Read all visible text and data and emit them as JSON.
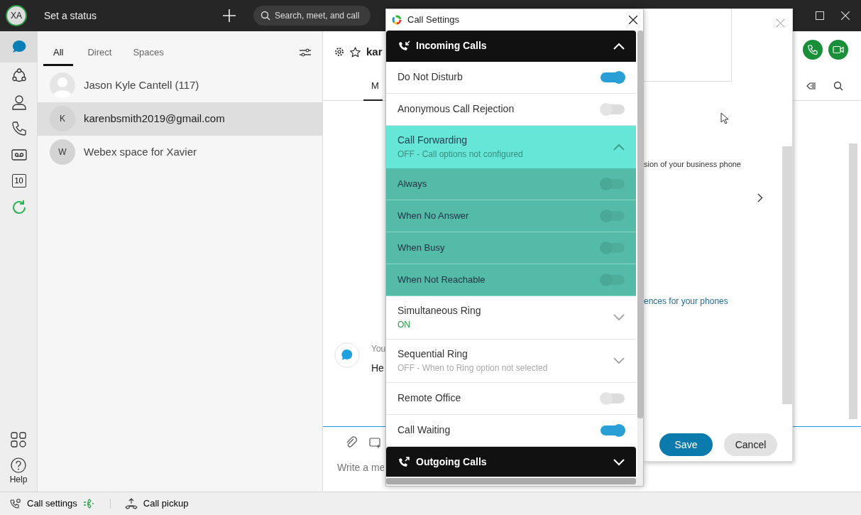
{
  "top_bar": {
    "avatar": "XA",
    "status": "Set a status",
    "search": {
      "placeholder": "Search, meet, and call"
    }
  },
  "rail": {
    "items": [
      {
        "kind": "messaging",
        "selected": true
      },
      {
        "kind": "teams",
        "selected": false
      },
      {
        "kind": "contacts",
        "selected": false
      },
      {
        "kind": "calls",
        "selected": false
      },
      {
        "kind": "voicemail",
        "selected": false
      },
      {
        "kind": "calendar",
        "label": "10",
        "selected": false
      },
      {
        "kind": "refresh",
        "selected": false
      }
    ],
    "help": "Help"
  },
  "list_tabs": [
    {
      "label": "All",
      "selected": true
    },
    {
      "label": "Direct",
      "selected": false
    },
    {
      "label": "Spaces",
      "selected": false
    }
  ],
  "conversations": [
    {
      "kind": "photo",
      "name": "Jason Kyle Cantell (117)",
      "selected": false
    },
    {
      "kind": "initial",
      "initial": "K",
      "name": "karenbsmith2019@gmail.com",
      "selected": true
    },
    {
      "kind": "initial",
      "initial": "W",
      "name": "Webex space for Xavier",
      "selected": false
    }
  ],
  "main": {
    "title": "kar",
    "tab": "M",
    "sender": "You",
    "message": "He",
    "composer": {
      "placeholder": "Write a me"
    }
  },
  "dialog": {
    "text": "sion of your business phone",
    "link": "ences for your phones",
    "buttons": [
      {
        "label": "Save",
        "kind": "primary"
      },
      {
        "label": "Cancel",
        "kind": "secondary"
      }
    ]
  },
  "call_settings": {
    "title": "Call Settings",
    "sections": [
      {
        "label": "Incoming Calls",
        "kind": "incoming",
        "expanded": true,
        "items": [
          {
            "kind": "toggle",
            "label": "Do Not Disturb",
            "on": true
          },
          {
            "kind": "toggle",
            "label": "Anonymous Call Rejection",
            "on": false
          },
          {
            "kind": "group",
            "label": "Call Forwarding",
            "status": "OFF - Call options not configured",
            "expanded": true,
            "children": [
              {
                "label": "Always",
                "on": false,
                "disabled": true
              },
              {
                "label": "When No Answer",
                "on": false,
                "disabled": true
              },
              {
                "label": "When Busy",
                "on": false,
                "disabled": true
              },
              {
                "label": "When Not Reachable",
                "on": false,
                "disabled": true
              }
            ]
          },
          {
            "kind": "expander",
            "label": "Simultaneous Ring",
            "status": "ON",
            "on": true,
            "expanded": false
          },
          {
            "kind": "expander",
            "label": "Sequential Ring",
            "status": "OFF - When to Ring option not selected",
            "on": false,
            "expanded": false
          },
          {
            "kind": "toggle",
            "label": "Remote Office",
            "on": false
          },
          {
            "kind": "toggle",
            "label": "Call Waiting",
            "on": true
          }
        ]
      },
      {
        "label": "Outgoing Calls",
        "kind": "outgoing",
        "expanded": false
      }
    ]
  },
  "status_bar": {
    "items": [
      {
        "kind": "settings",
        "label": "Call settings"
      },
      {
        "kind": "pickup",
        "label": "Call pickup"
      }
    ]
  }
}
